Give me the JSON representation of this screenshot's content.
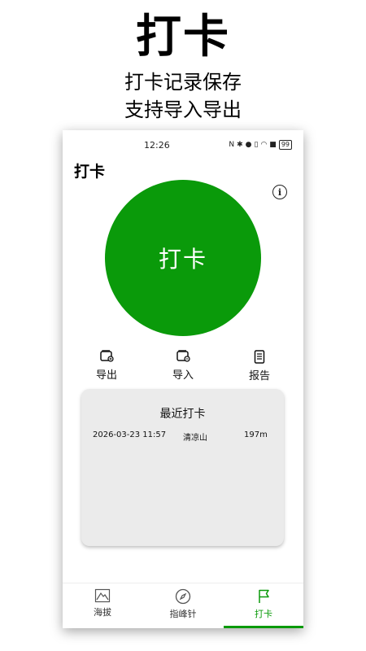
{
  "promo": {
    "title": "打卡",
    "subtitle_line1": "打卡记录保存",
    "subtitle_line2": "支持导入导出"
  },
  "status_bar": {
    "time": "12:26",
    "battery": "99"
  },
  "app": {
    "title": "打卡",
    "checkin_button": "打卡",
    "info_icon": "info-icon"
  },
  "actions": [
    {
      "label": "导出",
      "icon": "export-wallet-icon"
    },
    {
      "label": "导入",
      "icon": "import-wallet-icon"
    },
    {
      "label": "报告",
      "icon": "report-document-icon"
    }
  ],
  "recent": {
    "title": "最近打卡",
    "records": [
      {
        "time": "2026-03-23 11:57",
        "place": "清凉山",
        "altitude": "197m"
      }
    ]
  },
  "nav": [
    {
      "label": "海拔",
      "icon": "mountain-icon",
      "active": false
    },
    {
      "label": "指峰针",
      "icon": "compass-icon",
      "active": false
    },
    {
      "label": "打卡",
      "icon": "flag-icon",
      "active": true
    }
  ],
  "colors": {
    "accent": "#0a9a0a",
    "card_bg": "#ebebeb"
  }
}
